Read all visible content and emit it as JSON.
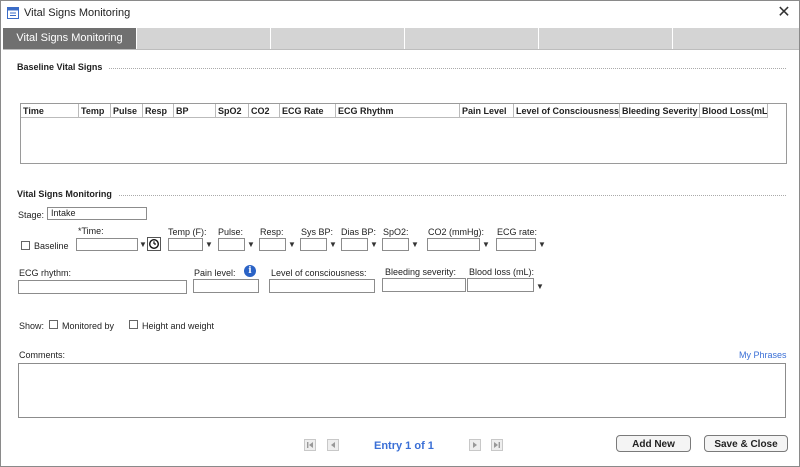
{
  "window": {
    "title": "Vital Signs Monitoring",
    "close_symbol": "✕"
  },
  "tabs": [
    {
      "label": "Vital Signs Monitoring"
    },
    {
      "label": ""
    },
    {
      "label": ""
    },
    {
      "label": ""
    },
    {
      "label": ""
    },
    {
      "label": ""
    }
  ],
  "baseline": {
    "section_title": "Baseline Vital Signs",
    "columns": [
      "Time",
      "Temp",
      "Pulse",
      "Resp",
      "BP",
      "SpO2",
      "CO2",
      "ECG Rate",
      "ECG Rhythm",
      "Pain Level",
      "Level of Consciousness",
      "Bleeding Severity",
      "Blood Loss(mL)"
    ]
  },
  "monitoring": {
    "section_title": "Vital Signs Monitoring",
    "stage_label": "Stage:",
    "stage_value": "Intake",
    "baseline_label": "Baseline",
    "time_label": "*Time:",
    "temp_label": "Temp (F):",
    "pulse_label": "Pulse:",
    "resp_label": "Resp:",
    "sys_bp_label": "Sys BP:",
    "dias_bp_label": "Dias BP:",
    "spo2_label": "SpO2:",
    "co2_label": "CO2 (mmHg):",
    "ecg_rate_label": "ECG rate:",
    "ecg_rhythm_label": "ECG rhythm:",
    "pain_level_label": "Pain level:",
    "consciousness_label": "Level of consciousness:",
    "bleeding_label": "Bleeding severity:",
    "blood_loss_label": "Blood loss (mL):",
    "dropdown_arrow": "▼",
    "info_symbol": "i"
  },
  "show": {
    "label": "Show:",
    "monitored_by": "Monitored by",
    "height_weight": "Height and weight"
  },
  "comments": {
    "label": "Comments:",
    "my_phrases": "My Phrases"
  },
  "footer": {
    "entry_text": "Entry 1 of 1",
    "add_new": "Add New",
    "save_close": "Save & Close"
  },
  "colors": {
    "accent": "#3a6fd6",
    "active_tab": "#707070",
    "tab_bar": "#d4d4d4"
  }
}
